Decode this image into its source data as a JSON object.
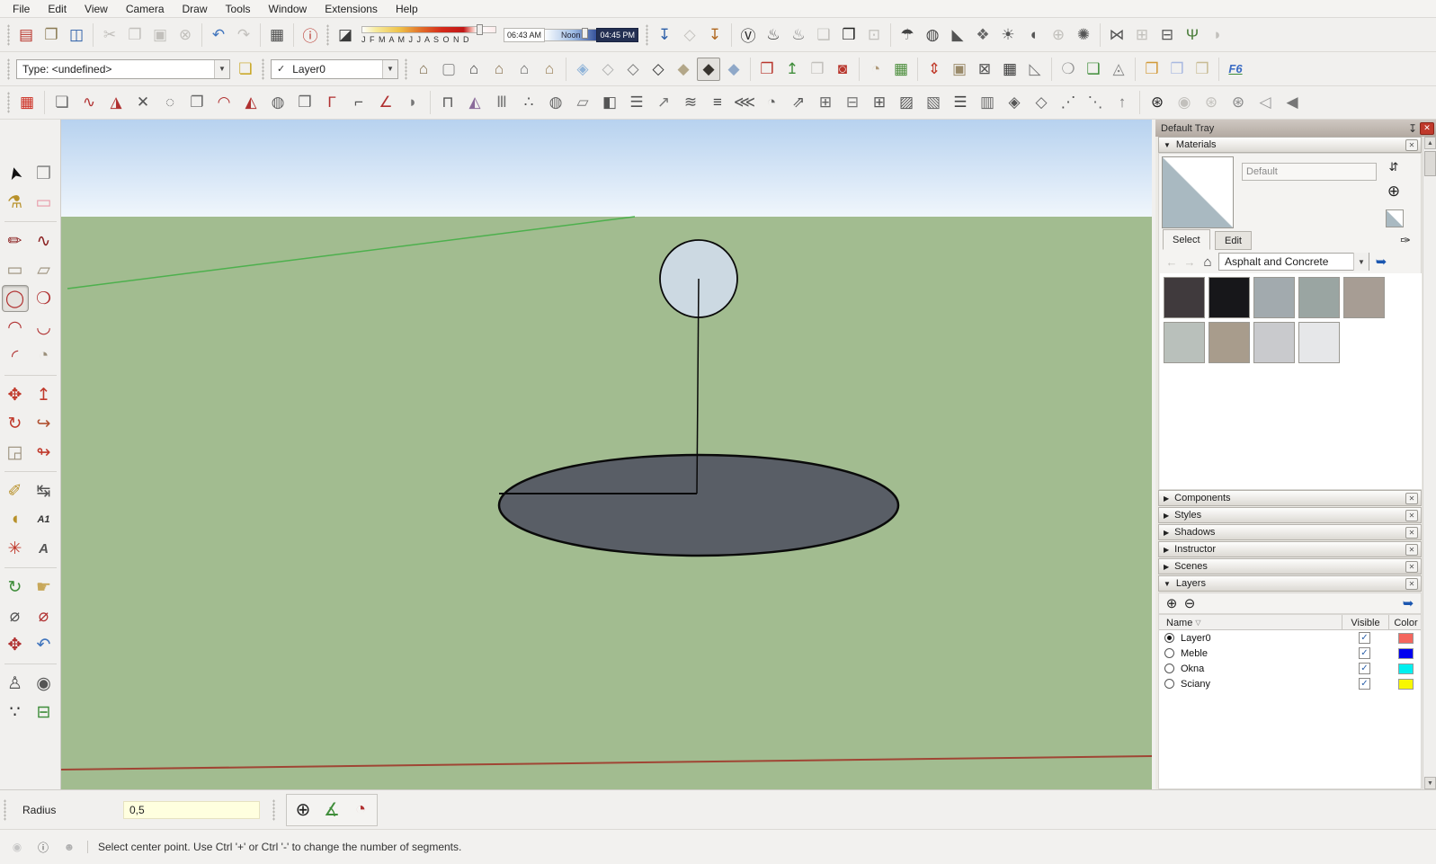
{
  "menu_bar": {
    "items": [
      "File",
      "Edit",
      "View",
      "Camera",
      "Draw",
      "Tools",
      "Window",
      "Extensions",
      "Help"
    ]
  },
  "toolbars": {
    "row1_standard": [
      {
        "n": "new-file-icon",
        "g": "▤",
        "c": "#b8352c"
      },
      {
        "n": "open-file-icon",
        "g": "❐",
        "c": "#8a7a52"
      },
      {
        "n": "save-file-icon",
        "g": "◫",
        "c": "#2d5fa8"
      },
      {
        "sep": 1
      },
      {
        "n": "cut-icon",
        "g": "✂",
        "d": 1
      },
      {
        "n": "copy-icon",
        "g": "❐",
        "d": 1
      },
      {
        "n": "paste-icon",
        "g": "▣",
        "d": 1
      },
      {
        "n": "cancel-icon",
        "g": "⊗",
        "d": 1
      },
      {
        "sep": 1
      },
      {
        "n": "undo-icon",
        "g": "↶",
        "c": "#3f74bd"
      },
      {
        "n": "redo-icon",
        "g": "↷",
        "d": 1
      },
      {
        "sep": 1
      },
      {
        "n": "print-icon",
        "g": "▦",
        "c": "#4a4a4a"
      },
      {
        "sep": 1
      },
      {
        "n": "model-info-icon",
        "g": "ⓘ",
        "c": "#b8352c"
      }
    ],
    "row1_shadow_toggle": [
      {
        "n": "shadows-toggle-icon",
        "g": "◪",
        "c": "#3a3a3a"
      }
    ],
    "shadows": {
      "months": "J F M A M J J A S O N D",
      "time_from": "06:43 AM",
      "time_noon": "Noon",
      "time_to": "04:45 PM"
    },
    "row1_right": [
      {
        "n": "add-location-icon",
        "g": "↧",
        "c": "#2d5fa8"
      },
      {
        "n": "toggle-terrain-icon",
        "g": "◇",
        "d": 1
      },
      {
        "n": "photo-textures-icon",
        "g": "↧",
        "c": "#b06820"
      },
      {
        "sep": 1
      },
      {
        "n": "vray-logo-icon",
        "g": "Ⓥ",
        "c": "#2a2a2a"
      },
      {
        "n": "vray-render-icon",
        "g": "♨",
        "c": "#3a3a3a"
      },
      {
        "n": "vray-interactive-render-icon",
        "g": "♨",
        "c": "#777777"
      },
      {
        "n": "vray-frame-buffer-icon",
        "g": "❑",
        "d": 1
      },
      {
        "n": "vray-render-window-icon",
        "g": "❒",
        "c": "#222222"
      },
      {
        "n": "vray-lock-icon",
        "g": "⊡",
        "d": 1
      },
      {
        "sep": 1
      },
      {
        "n": "vray-dome-light-icon",
        "g": "☂",
        "c": "#444444"
      },
      {
        "n": "vray-sphere-light-icon",
        "g": "◍",
        "c": "#444444"
      },
      {
        "n": "vray-spot-light-icon",
        "g": "◣",
        "c": "#555555"
      },
      {
        "n": "vray-ies-light-icon",
        "g": "❖",
        "c": "#666666"
      },
      {
        "n": "vray-omni-light-icon",
        "g": "☀",
        "c": "#555555"
      },
      {
        "n": "vray-rect-light-icon",
        "g": "◖",
        "c": "#555555"
      },
      {
        "n": "vray-mesh-light-icon",
        "g": "⊕",
        "d": 1
      },
      {
        "n": "vray-sun-light-icon",
        "g": "✺",
        "c": "#555555"
      },
      {
        "sep": 1
      },
      {
        "n": "vray-infinite-plane-icon",
        "g": "⋈",
        "c": "#555555"
      },
      {
        "n": "vray-proxy-import-icon",
        "g": "⊞",
        "d": 1
      },
      {
        "n": "vray-proxy-export-icon",
        "g": "⊟",
        "c": "#555555"
      },
      {
        "n": "vray-fur-icon",
        "g": "Ψ",
        "c": "#4a7d3a"
      },
      {
        "n": "vray-clipper-icon",
        "g": "◗",
        "d": 1
      }
    ],
    "classifier": {
      "type_label": "Type: <undefined>"
    },
    "classifier_icon": [
      {
        "n": "classifier-tags-icon",
        "g": "❏",
        "c": "#c8a520"
      }
    ],
    "layer": {
      "check": "✓",
      "value": "Layer0"
    },
    "row2_right": [
      {
        "n": "iso-view-icon",
        "g": "⌂",
        "c": "#7d6a4a"
      },
      {
        "n": "top-view-icon",
        "g": "▢",
        "c": "#8a8a8a"
      },
      {
        "n": "front-view-icon",
        "g": "⌂",
        "c": "#444444"
      },
      {
        "n": "back-view-icon",
        "g": "⌂",
        "c": "#8a7250"
      },
      {
        "n": "left-view-icon",
        "g": "⌂",
        "c": "#666666"
      },
      {
        "n": "right-view-icon",
        "g": "⌂",
        "c": "#997f55"
      },
      {
        "sep": 1
      },
      {
        "n": "xray-mode-icon",
        "g": "◈",
        "c": "#8fb3d8"
      },
      {
        "n": "back-edges-mode-icon",
        "g": "◇",
        "c": "#b0b0b0"
      },
      {
        "n": "wireframe-mode-icon",
        "g": "◇",
        "c": "#777777"
      },
      {
        "n": "hidden-line-mode-icon",
        "g": "◇",
        "c": "#333333"
      },
      {
        "n": "shaded-mode-icon",
        "g": "◆",
        "c": "#b3a789"
      },
      {
        "n": "shaded-textures-mode-icon",
        "g": "◆",
        "c": "#38342e",
        "a": 1
      },
      {
        "n": "monochrome-mode-icon",
        "g": "◆",
        "c": "#8fa8c8"
      },
      {
        "sep": 1
      },
      {
        "n": "extension-warehouse-icon",
        "g": "❒",
        "c": "#b8352c"
      },
      {
        "n": "share-model-icon",
        "g": "↥",
        "c": "#3f8d3a"
      },
      {
        "n": "download-model-icon",
        "g": "❒",
        "d": 1
      },
      {
        "n": "send-to-layout-icon",
        "g": "◙",
        "c": "#b8352c"
      },
      {
        "sep": 1
      },
      {
        "n": "sandbox-from-contours-icon",
        "g": "◔",
        "c": "#b09a7a"
      },
      {
        "n": "sandbox-from-scratch-icon",
        "g": "▦",
        "c": "#4a8d3a"
      },
      {
        "sep": 1
      },
      {
        "n": "smoove-icon",
        "g": "⇕",
        "c": "#c03a2a"
      },
      {
        "n": "stamp-icon",
        "g": "▣",
        "c": "#9a8a6a"
      },
      {
        "n": "drape-icon",
        "g": "⊠",
        "c": "#555555"
      },
      {
        "n": "add-detail-icon",
        "g": "▦",
        "c": "#3a3a3a"
      },
      {
        "n": "flip-edge-icon",
        "g": "◺",
        "c": "#777777"
      },
      {
        "sep": 1
      },
      {
        "n": "shell-tool-icon",
        "g": "❍",
        "c": "#999999"
      },
      {
        "n": "soap-skin-icon",
        "g": "❑",
        "c": "#3f8d3a"
      },
      {
        "n": "bubble-tool-icon",
        "g": "◬",
        "c": "#888888"
      },
      {
        "sep": 1
      },
      {
        "n": "round-corner-icon",
        "g": "❒",
        "c": "#d29a3a"
      },
      {
        "n": "sharp-corner-icon",
        "g": "❒",
        "c": "#a8b8e0"
      },
      {
        "n": "bevel-icon",
        "g": "❒",
        "c": "#c8bc94"
      },
      {
        "sep": 1
      },
      {
        "n": "libfredo-f6-icon",
        "t": "F6",
        "c": "#3a6bc4",
        "u": 1
      }
    ],
    "row3": [
      {
        "n": "material-replacer-icon",
        "g": "▦",
        "c": "#cc2a1e"
      },
      {
        "sep": 1
      },
      {
        "n": "loft-spline-icon",
        "g": "❏",
        "c": "#666666"
      },
      {
        "n": "bezier-curve-icon",
        "g": "∿",
        "c": "#b03030"
      },
      {
        "n": "curviloft-icon",
        "g": "◮",
        "c": "#b03030"
      },
      {
        "n": "intersect-lines-icon",
        "g": "✕",
        "c": "#555555"
      },
      {
        "n": "polygon-dashed-icon",
        "g": "◌",
        "c": "#666666"
      },
      {
        "n": "extrude-edges-icon",
        "g": "❐",
        "c": "#666666"
      },
      {
        "n": "pipe-along-path-icon",
        "g": "◠",
        "c": "#b03030"
      },
      {
        "n": "tent-shape-icon",
        "g": "◭",
        "c": "#b03030"
      },
      {
        "n": "sphere-pin-icon",
        "g": "◍",
        "c": "#666666"
      },
      {
        "n": "point-box-icon",
        "g": "❒",
        "c": "#666666"
      },
      {
        "n": "fillet-corner-icon",
        "g": "Γ",
        "c": "#b03030"
      },
      {
        "n": "corner-line-icon",
        "g": "⌐",
        "c": "#555555"
      },
      {
        "n": "angle-tool-icon",
        "g": "∠",
        "c": "#b03030"
      },
      {
        "n": "curve-sheet-icon",
        "g": "◗",
        "c": "#777777"
      },
      {
        "sep": 1
      },
      {
        "n": "wall-tool-icon",
        "g": "⊓",
        "c": "#555555"
      },
      {
        "n": "pyramid-tool-icon",
        "g": "◭",
        "c": "#8a6a9a"
      },
      {
        "n": "columns-tool-icon",
        "g": "Ⅲ",
        "c": "#777777"
      },
      {
        "n": "column-array-icon",
        "g": "∴",
        "c": "#555555"
      },
      {
        "n": "circular-array-icon",
        "g": "◍",
        "c": "#666666"
      },
      {
        "n": "panel-tool-icon",
        "g": "▱",
        "c": "#777777"
      },
      {
        "n": "door-tool-icon",
        "g": "◧",
        "c": "#555555"
      },
      {
        "n": "louver-tool-icon",
        "g": "☰",
        "c": "#555555"
      },
      {
        "n": "ramp-tool-icon",
        "g": "↗",
        "c": "#777777"
      },
      {
        "n": "stair-flight-icon",
        "g": "≋",
        "c": "#555555"
      },
      {
        "n": "staircase-icon",
        "g": "≡",
        "c": "#444444"
      },
      {
        "n": "wide-stair-icon",
        "g": "⋘",
        "c": "#555555"
      },
      {
        "n": "spiral-stair-icon",
        "g": "◔",
        "c": "#666666"
      },
      {
        "n": "escalator-icon",
        "g": "⇗",
        "c": "#555555"
      },
      {
        "n": "window-frame-icon",
        "g": "⊞",
        "c": "#666666"
      },
      {
        "n": "door-frame-icon",
        "g": "⊟",
        "c": "#777777"
      },
      {
        "n": "window-grid-icon",
        "g": "⊞",
        "c": "#555555"
      },
      {
        "n": "hatch-pattern-icon",
        "g": "▨",
        "c": "#555555"
      },
      {
        "n": "diagonal-pattern-icon",
        "g": "▧",
        "c": "#666666"
      },
      {
        "n": "louver-stack-icon",
        "g": "☰",
        "c": "#444444"
      },
      {
        "n": "panel-array-icon",
        "g": "▥",
        "c": "#666666"
      },
      {
        "n": "chevron-frame-icon",
        "g": "◈",
        "c": "#555555"
      },
      {
        "n": "chevron-outline-icon",
        "g": "◇",
        "c": "#666666"
      },
      {
        "n": "rafters-icon",
        "g": "⋰",
        "c": "#555555"
      },
      {
        "n": "purlins-icon",
        "g": "⋱",
        "c": "#666666"
      },
      {
        "n": "roof-tool-icon",
        "g": "↑",
        "c": "#777777"
      },
      {
        "sep": 1
      },
      {
        "n": "add-camera-icon",
        "g": "⊛",
        "c": "#222222"
      },
      {
        "n": "preview-camera-icon",
        "g": "◉",
        "d": 1
      },
      {
        "n": "lock-camera-icon",
        "g": "⊛",
        "d": 1
      },
      {
        "n": "cameras-icon",
        "g": "⊛",
        "c": "#888888"
      },
      {
        "n": "view-frustum-icon",
        "g": "◁",
        "c": "#999999"
      },
      {
        "n": "view-frustum-solid-icon",
        "g": "◀",
        "c": "#777777"
      }
    ]
  },
  "left_toolbar": [
    {
      "n": "select-tool-icon",
      "g": "➤",
      "c": "#111111",
      "r": -105
    },
    {
      "n": "make-component-icon",
      "g": "❒",
      "c": "#8a8a8a"
    },
    {
      "n": "paint-bucket-icon",
      "g": "⚗",
      "c": "#b8912a"
    },
    {
      "n": "eraser-icon",
      "g": "▭",
      "c": "#e89aa8"
    },
    {
      "sep": 1
    },
    {
      "n": "line-tool-icon",
      "g": "✏",
      "c": "#8a2020"
    },
    {
      "n": "freehand-tool-icon",
      "g": "∿",
      "c": "#8a2020"
    },
    {
      "n": "rectangle-tool-icon",
      "g": "▭",
      "c": "#9a8f7a"
    },
    {
      "n": "rotated-rectangle-icon",
      "g": "▱",
      "c": "#9a8f7a"
    },
    {
      "n": "circle-tool-icon",
      "g": "◯",
      "c": "#b03030",
      "a": 1
    },
    {
      "n": "polygon-tool-icon",
      "g": "❍",
      "c": "#b03030"
    },
    {
      "n": "arc-tool-icon",
      "g": "◠",
      "c": "#b03030"
    },
    {
      "n": "two-point-arc-icon",
      "g": "◡",
      "c": "#b03030"
    },
    {
      "n": "three-point-arc-icon",
      "g": "◜",
      "c": "#b03030"
    },
    {
      "n": "pie-tool-icon",
      "g": "◔",
      "c": "#9a8f7a"
    },
    {
      "sep": 1
    },
    {
      "n": "move-tool-icon",
      "g": "✥",
      "c": "#c0392b"
    },
    {
      "n": "push-pull-icon",
      "g": "↥",
      "c": "#c0392b"
    },
    {
      "n": "rotate-tool-icon",
      "g": "↻",
      "c": "#c0392b"
    },
    {
      "n": "follow-me-icon",
      "g": "↪",
      "c": "#b05030"
    },
    {
      "n": "scale-tool-icon",
      "g": "◲",
      "c": "#9a8f7a"
    },
    {
      "n": "offset-tool-icon",
      "g": "↬",
      "c": "#c0392b"
    },
    {
      "sep": 1
    },
    {
      "n": "tape-measure-icon",
      "g": "✐",
      "c": "#b8912a"
    },
    {
      "n": "dimensions-icon",
      "g": "↹",
      "c": "#555555"
    },
    {
      "n": "protractor-icon",
      "g": "◖",
      "c": "#b8912a"
    },
    {
      "n": "text-tool-icon",
      "t": "A1",
      "c": "#333333",
      "fs": 11
    },
    {
      "n": "axes-tool-icon",
      "g": "✳",
      "c": "#c0392b"
    },
    {
      "n": "3d-text-icon",
      "t": "A",
      "c": "#555555",
      "fs": 15
    },
    {
      "sep": 1
    },
    {
      "n": "orbit-tool-icon",
      "g": "↻",
      "c": "#3f8d3a"
    },
    {
      "n": "pan-tool-icon",
      "g": "☛",
      "c": "#c8a85a"
    },
    {
      "n": "zoom-tool-icon",
      "g": "⌀",
      "c": "#555555"
    },
    {
      "n": "zoom-window-icon",
      "g": "⌀",
      "c": "#b03030"
    },
    {
      "n": "zoom-extents-icon",
      "g": "✥",
      "c": "#b03030"
    },
    {
      "n": "previous-view-icon",
      "g": "↶",
      "c": "#3f74bd"
    },
    {
      "sep": 1
    },
    {
      "n": "position-camera-icon",
      "g": "♙",
      "c": "#555555"
    },
    {
      "n": "look-around-icon",
      "g": "◉",
      "c": "#555555"
    },
    {
      "n": "walk-tool-icon",
      "g": "∵",
      "c": "#333333"
    },
    {
      "n": "section-plane-icon",
      "g": "⊟",
      "c": "#3f8d3a"
    }
  ],
  "scene": {
    "sky_top": "#b7d2ef",
    "sky_horizon": "#f0f6fc",
    "ground": "#a2bc90",
    "green_axis": "#4db04d",
    "red_axis": "#a04534",
    "edge": "#0a0a0a",
    "circle_fill": "#ccd9e2",
    "disc_fill": "#595e66"
  },
  "tray": {
    "title": "Default Tray",
    "materials": {
      "title": "Materials",
      "name_value": "Default",
      "tab_select": "Select",
      "tab_edit": "Edit",
      "collection": "Asphalt and Concrete",
      "swatches": [
        {
          "c": "#403a3d"
        },
        {
          "c": "#17171a"
        },
        {
          "c": "#a2aaae"
        },
        {
          "c": "#9aa5a2"
        },
        {
          "c": "#a79d94"
        },
        {
          "c": "#b9c0bb"
        },
        {
          "c": "#a89c8c",
          "s": 1
        },
        {
          "c": "#c9cacd"
        },
        {
          "c": "#e6e7e9"
        }
      ]
    },
    "panels": [
      "Components",
      "Styles",
      "Shadows",
      "Instructor",
      "Scenes"
    ],
    "layers": {
      "title": "Layers",
      "col_name": "Name",
      "col_visible": "Visible",
      "col_color": "Color",
      "rows": [
        {
          "name": "Layer0",
          "current": true,
          "visible": true,
          "color": "#f4665e"
        },
        {
          "name": "Meble",
          "current": false,
          "visible": true,
          "color": "#0000f0"
        },
        {
          "name": "Okna",
          "current": false,
          "visible": true,
          "color": "#00f0f0"
        },
        {
          "name": "Sciany",
          "current": false,
          "visible": true,
          "color": "#f8f800"
        }
      ]
    }
  },
  "measurements": {
    "label": "Radius",
    "value": "0,5",
    "tools": [
      {
        "n": "circle-center-tool-icon",
        "g": "⊕",
        "c": "#222222"
      },
      {
        "n": "angle-guide-tool-icon",
        "g": "∡",
        "c": "#3f8d3a"
      },
      {
        "n": "arc-calculator-tool-icon",
        "g": "◔",
        "c": "#b03030"
      }
    ]
  },
  "status_bar": {
    "icons": [
      {
        "n": "geolocation-status-icon",
        "g": "◉",
        "c": "#c4c4c4"
      },
      {
        "n": "claim-credit-icon",
        "g": "ⓘ",
        "c": "#444444"
      },
      {
        "n": "sign-in-icon",
        "g": "☻",
        "c": "#b0b0b0"
      }
    ],
    "message": "Select center point. Use Ctrl '+' or Ctrl '-' to change the number of segments."
  }
}
